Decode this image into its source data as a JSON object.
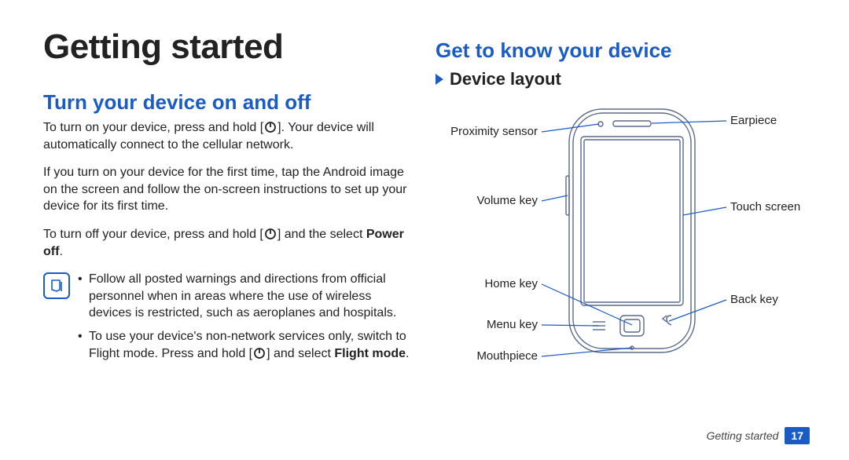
{
  "left": {
    "title": "Getting started",
    "h2_1": "Turn your device on and off",
    "p1_a": "To turn on your device, press and hold [",
    "p1_b": "]. Your device will automatically connect to the cellular network.",
    "p2": "If you turn on your device for the first time, tap the Android image on the screen and follow the on-screen instructions to set up your device for its first time.",
    "p3_a": "To turn off your device, press and hold [",
    "p3_b": "] and the select ",
    "p3_bold": "Power off",
    "p3_end": ".",
    "note1": "Follow all posted warnings and directions from official personnel when in areas where the use of wireless devices is restricted, such as aeroplanes and hospitals.",
    "note2_a": "To use your device's non-network services only, switch to Flight mode. Press and hold [",
    "note2_b": "] and select ",
    "note2_bold": "Flight mode",
    "note2_end": "."
  },
  "right": {
    "h2": "Get to know your device",
    "h3": "Device layout",
    "labels": {
      "proximity": "Proximity sensor",
      "volume": "Volume key",
      "home": "Home key",
      "menu": "Menu key",
      "mouthpiece": "Mouthpiece",
      "earpiece": "Earpiece",
      "touchscreen": "Touch screen",
      "back": "Back key"
    }
  },
  "footer": {
    "section": "Getting started",
    "page": "17"
  }
}
